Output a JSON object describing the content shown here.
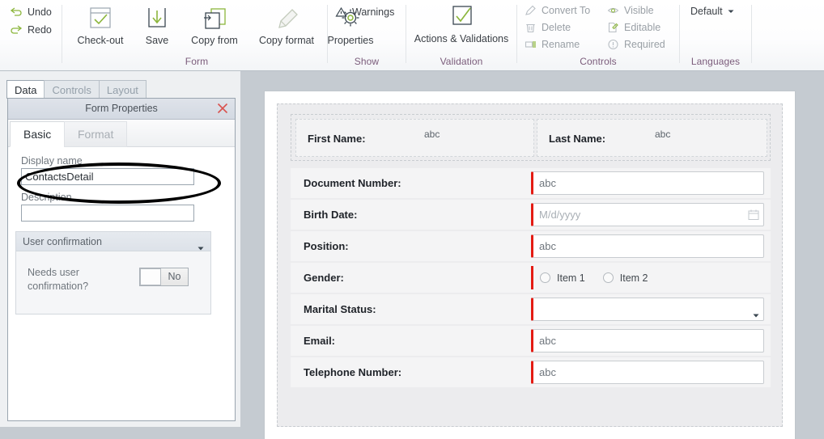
{
  "ribbon": {
    "quick": [
      {
        "label": "Undo",
        "icon": "undo-arrow-icon"
      },
      {
        "label": "Redo",
        "icon": "redo-arrow-icon"
      }
    ],
    "groups": [
      {
        "name": "Form",
        "label": "Form",
        "buttons": [
          {
            "label": "Check-out",
            "icon": "checkout-check-box-icon"
          },
          {
            "label": "Save",
            "icon": "save-down-arrow-icon"
          },
          {
            "label": "Copy from",
            "icon": "copy-from-pages-icon"
          },
          {
            "label": "Copy format",
            "icon": "format-painter-brush-icon"
          },
          {
            "label": "Properties",
            "icon": "gear-icon"
          }
        ]
      },
      {
        "name": "Show",
        "label": "Show",
        "buttons": [
          {
            "label": "Warnings",
            "icon": "warning-triangle-icon"
          }
        ]
      },
      {
        "name": "Validation",
        "label": "Validation",
        "buttons": [
          {
            "label": "Actions & Validations",
            "icon": "check-box-icon"
          }
        ]
      },
      {
        "name": "Controls",
        "label": "Controls",
        "buttons": [
          {
            "label": "Convert To",
            "icon": "convert-pencil-icon"
          },
          {
            "label": "Delete",
            "icon": "trash-icon"
          },
          {
            "label": "Rename",
            "icon": "rename-tag-icon"
          },
          {
            "label": "Visible",
            "icon": "eye-icon"
          },
          {
            "label": "Editable",
            "icon": "edit-page-icon"
          },
          {
            "label": "Required",
            "icon": "required-exclamation-icon"
          }
        ]
      },
      {
        "name": "Languages",
        "label": "Languages",
        "buttons": [
          {
            "label": "Default",
            "icon": "chevron-down-icon"
          }
        ]
      }
    ]
  },
  "sidebar": {
    "tabs": [
      {
        "label": "Data",
        "active": true
      },
      {
        "label": "Controls",
        "active": false
      },
      {
        "label": "Layout",
        "active": false
      }
    ],
    "panel": {
      "title": "Form Properties",
      "close_icon": "close-icon",
      "subtabs": [
        {
          "label": "Basic",
          "active": true
        },
        {
          "label": "Format",
          "active": false
        }
      ],
      "display_name": {
        "label": "Display name",
        "value": "ContactsDetail",
        "highlighted": true
      },
      "description": {
        "label": "Description",
        "value": "",
        "placeholder": ""
      },
      "user_confirmation": {
        "group_label": "User confirmation",
        "caret_icon": "caret-down-icon",
        "field_label": "Needs user confirmation?",
        "toggle_value": "No"
      }
    }
  },
  "canvas": {
    "pair_row": [
      {
        "label": "First Name:",
        "value": "abc"
      },
      {
        "label": "Last Name:",
        "value": "abc"
      }
    ],
    "rows": [
      {
        "label": "Document Number:",
        "type": "text",
        "value": "abc",
        "required": true
      },
      {
        "label": "Birth Date:",
        "type": "date",
        "value": "M/d/yyyy",
        "placeholder": true,
        "required": true,
        "icon": "calendar-icon"
      },
      {
        "label": "Position:",
        "type": "text",
        "value": "abc",
        "required": true
      },
      {
        "label": "Gender:",
        "type": "radio",
        "required": true,
        "options": [
          "Item 1",
          "Item 2"
        ]
      },
      {
        "label": "Marital Status:",
        "type": "dropdown",
        "value": "",
        "required": true,
        "icon": "caret-down-icon"
      },
      {
        "label": "Email:",
        "type": "text",
        "value": "abc",
        "required": true
      },
      {
        "label": "Telephone Number:",
        "type": "text",
        "value": "abc",
        "required": true
      }
    ]
  },
  "colors": {
    "required_marker": "#e41b13",
    "group_label": "#7b5c7b",
    "accent_green": "#8cb63c",
    "close_red": "#d9534f"
  }
}
